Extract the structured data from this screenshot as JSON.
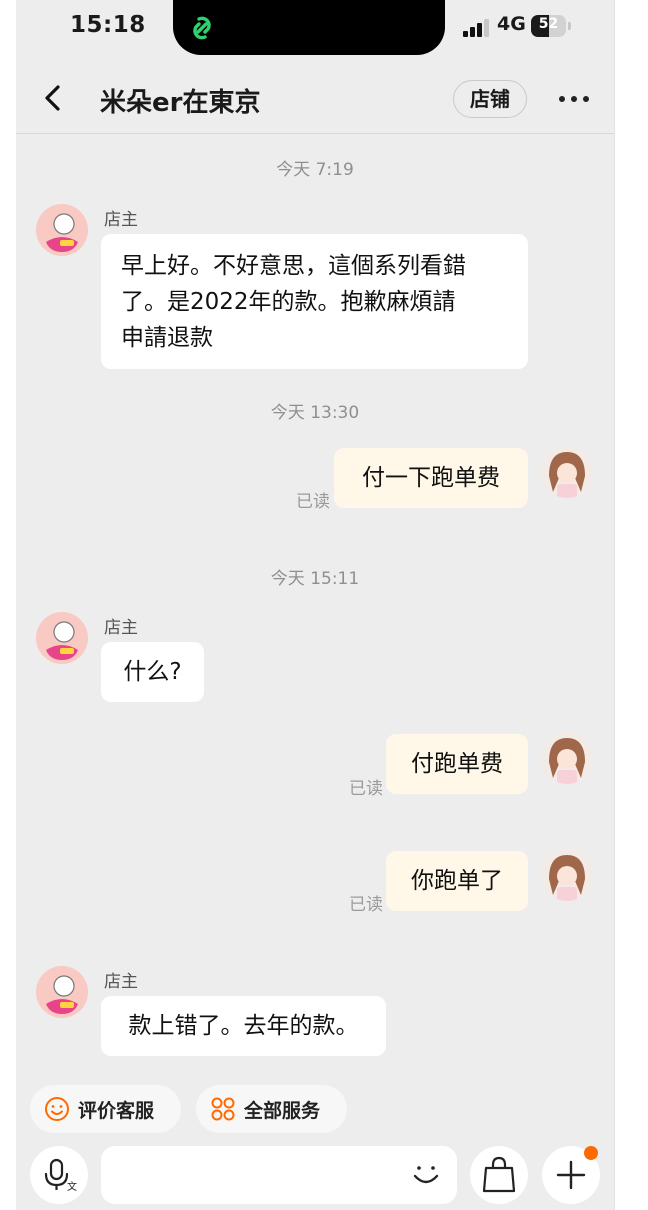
{
  "status_bar": {
    "time": "15:18",
    "network": "4G",
    "battery": "52",
    "battery_level": 0.52
  },
  "header": {
    "title": "米朵er在東京",
    "store_button": "店铺"
  },
  "colors": {
    "accent": "#ff6a00",
    "outgoing_bubble": "#fff7e7",
    "incoming_bubble": "#ffffff",
    "background": "#ededed"
  },
  "messages": [
    {
      "type": "timestamp",
      "text": "今天 7:19"
    },
    {
      "type": "incoming",
      "sender": "店主",
      "lines": [
        "早上好。不好意思，這個系列看錯",
        "了。是2022年的款。抱歉麻煩請",
        "申請退款"
      ]
    },
    {
      "type": "timestamp",
      "text": "今天 13:30"
    },
    {
      "type": "outgoing",
      "text": "付一下跑单费",
      "status": "已读"
    },
    {
      "type": "timestamp",
      "text": "今天 15:11"
    },
    {
      "type": "incoming",
      "sender": "店主",
      "text": "什么?"
    },
    {
      "type": "outgoing",
      "text": "付跑单费",
      "status": "已读"
    },
    {
      "type": "outgoing",
      "text": "你跑单了",
      "status": "已读"
    },
    {
      "type": "incoming",
      "sender": "店主",
      "text": "款上错了。去年的款。"
    }
  ],
  "quick_actions": [
    {
      "label": "评价客服",
      "icon": "smiley-icon"
    },
    {
      "label": "全部服务",
      "icon": "grid-icon"
    }
  ],
  "input_bar": {
    "voice_icon": "voice-input-icon",
    "emoji_icon": "emoji-icon",
    "bag_icon": "shopping-bag-icon",
    "plus_icon": "plus-icon"
  }
}
